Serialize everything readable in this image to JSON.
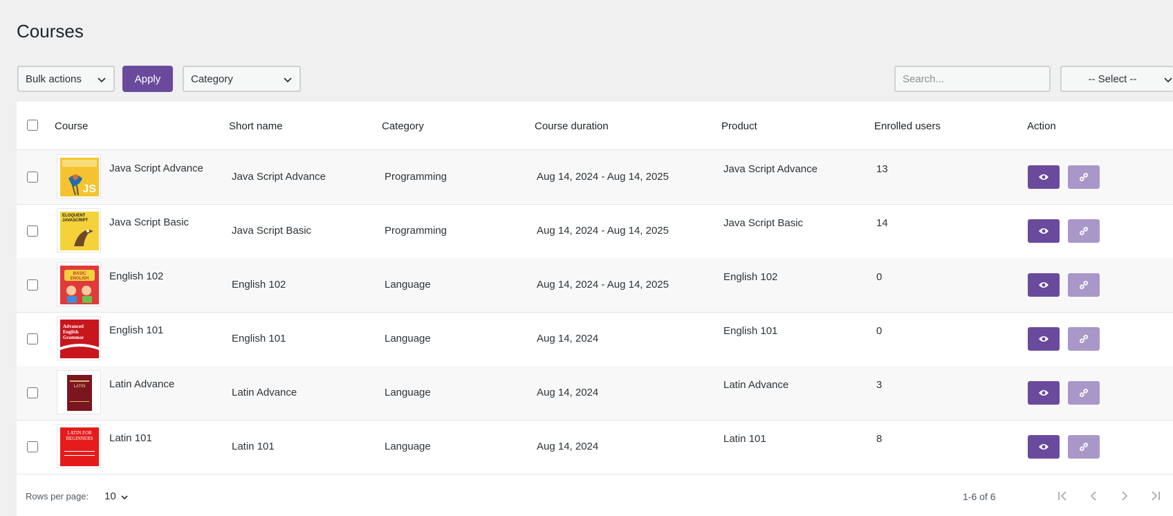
{
  "page": {
    "title": "Courses"
  },
  "toolbar": {
    "bulk_actions": "Bulk actions",
    "apply": "Apply",
    "category": "Category",
    "search_placeholder": "Search...",
    "select": "-- Select --"
  },
  "table": {
    "headers": [
      "Course",
      "Short name",
      "Category",
      "Course duration",
      "Product",
      "Enrolled users",
      "Action"
    ],
    "rows": [
      {
        "course": "Java Script Advance",
        "short_name": "Java Script Advance",
        "category": "Programming",
        "duration": "Aug 14, 2024 - Aug 14, 2025",
        "product": "Java Script Advance",
        "enrolled": "13",
        "cover_text": "JS"
      },
      {
        "course": "Java Script Basic",
        "short_name": "Java Script Basic",
        "category": "Programming",
        "duration": "Aug 14, 2024 - Aug 14, 2025",
        "product": "Java Script Basic",
        "enrolled": "14",
        "cover_text": "ELOQUENT JAVASCRIPT"
      },
      {
        "course": "English 102",
        "short_name": "English 102",
        "category": "Language",
        "duration": "Aug 14, 2024 - Aug 14, 2025",
        "product": "English 102",
        "enrolled": "0",
        "cover_text": "BASIC ENGLISH"
      },
      {
        "course": "English 101",
        "short_name": "English 101",
        "category": "Language",
        "duration": "Aug 14, 2024",
        "product": "English 101",
        "enrolled": "0",
        "cover_text": "Advanced English Grammar"
      },
      {
        "course": "Latin Advance",
        "short_name": "Latin Advance",
        "category": "Language",
        "duration": "Aug 14, 2024",
        "product": "Latin Advance",
        "enrolled": "3",
        "cover_text": "LATIN"
      },
      {
        "course": "Latin 101",
        "short_name": "Latin 101",
        "category": "Language",
        "duration": "Aug 14, 2024",
        "product": "Latin 101",
        "enrolled": "8",
        "cover_text": "LATIN FOR BEGINNERS"
      }
    ]
  },
  "footer": {
    "rows_label": "Rows per page:",
    "rows_value": "10",
    "range": "1-6 of 6"
  },
  "colors": {
    "accent": "#6a4a9c",
    "accent_light": "#a897c8"
  }
}
